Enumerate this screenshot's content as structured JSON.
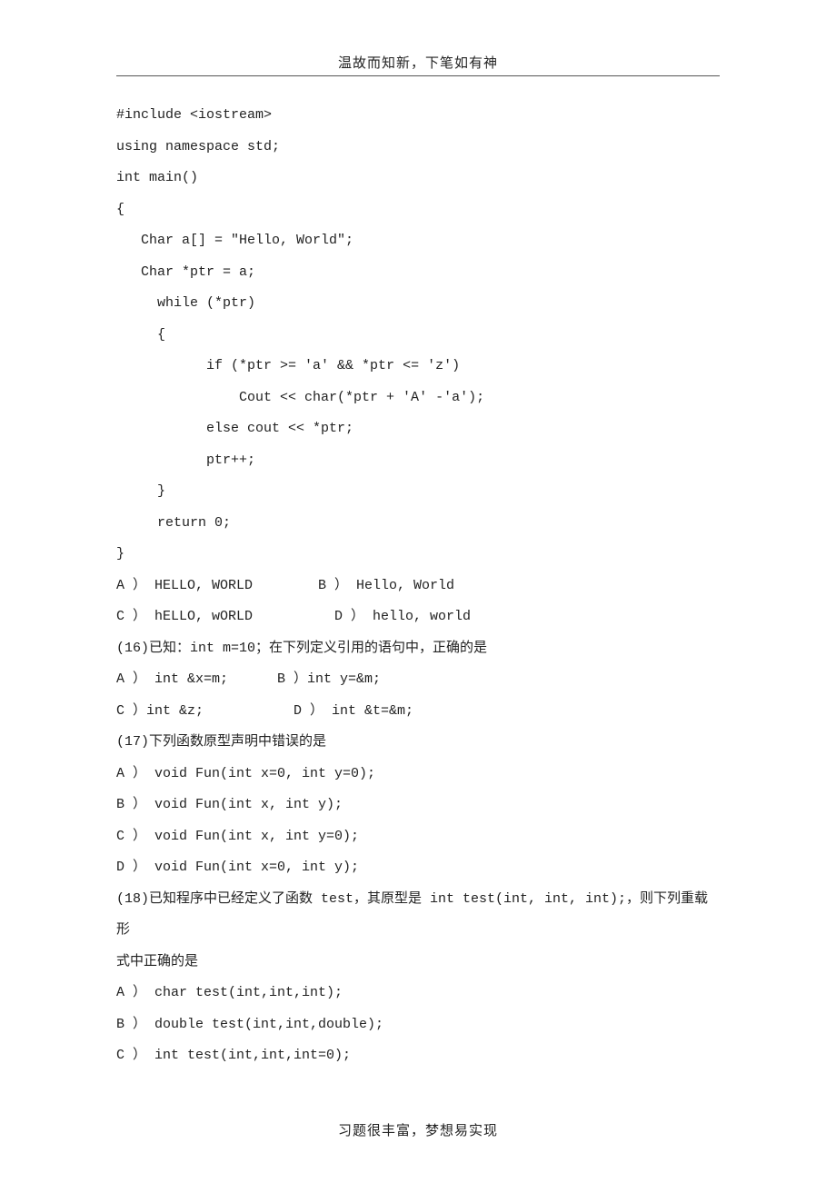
{
  "header": "温故而知新，下笔如有神",
  "footer": "习题很丰富，梦想易实现",
  "lines": {
    "l0": "#include <iostream>",
    "l1": "using namespace std;",
    "l2": "int main()",
    "l3": "{",
    "l4": "   Char a[] = \"Hello, World\";",
    "l5": "   Char *ptr = a;",
    "l6": "     while (*ptr)",
    "l7": "     {",
    "l8": "           if (*ptr >= 'a' && *ptr <= 'z')",
    "l9": "               Cout << char(*ptr + 'A' -'a');",
    "l10": "           else cout << *ptr;",
    "l11": "           ptr++;",
    "l12": "     }",
    "l13": "     return 0;",
    "l14": "}",
    "l15": "A ） HELLO, WORLD        B ） Hello, World",
    "l16": "C ） hELLO, wORLD          D ） hello, world",
    "l17": "(16)已知：int m=10；在下列定义引用的语句中，正确的是",
    "l18": "A ） int &x=m;      B ）int y=&m;",
    "l19": "C ）int &z;           D ） int &t=&m;",
    "l20": "(17)下列函数原型声明中错误的是",
    "l21": "A ） void Fun(int x=0, int y=0);",
    "l22": "B ） void Fun(int x, int y);",
    "l23": "C ） void Fun(int x, int y=0);",
    "l24": "D ） void Fun(int x=0, int y);",
    "l25": "(18)已知程序中已经定义了函数 test，其原型是 int test(int, int, int);，则下列重载形",
    "l26": "式中正确的是",
    "l27": "A ） char test(int,int,int);",
    "l28": "B ） double test(int,int,double);",
    "l29": "C ） int test(int,int,int=0);"
  }
}
